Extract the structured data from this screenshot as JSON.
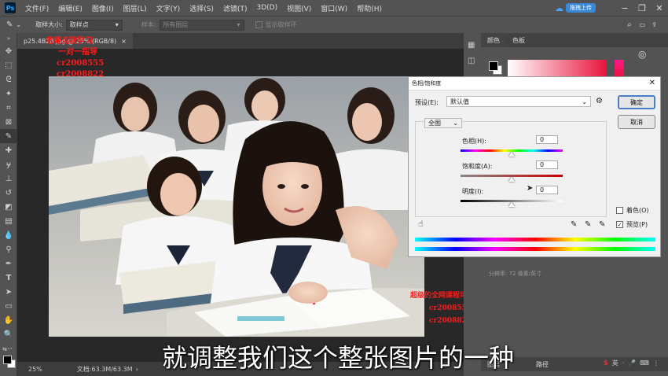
{
  "menubar": {
    "logo": "Ps",
    "items": [
      "文件(F)",
      "编辑(E)",
      "图像(I)",
      "图层(L)",
      "文字(Y)",
      "选择(S)",
      "滤镜(T)",
      "3D(D)",
      "视图(V)",
      "窗口(W)",
      "帮助(H)"
    ],
    "upload_label": "拖拽上传"
  },
  "options": {
    "sample_size_label": "取样大小:",
    "sample_size_value": "取样点",
    "sample_label": "样本:",
    "sample_value": "所有图层",
    "show_ring_label": "显示取样环"
  },
  "document": {
    "tab_label": "p25.4B28.jpg @ 25% (RGB/8)",
    "zoom": "25%",
    "doc_info": "文档:63.3M/63.3M"
  },
  "watermarks": {
    "top_lines": [
      "老师点我学习",
      "一对一指导",
      "cr2008555",
      "cr2008822"
    ],
    "bottom_lines": [
      "超级的全网课程可看",
      "cr2008555",
      "cr2008822"
    ]
  },
  "subtitle": "就调整我们这个整张图片的一种",
  "panels": {
    "color_tab": "颜色",
    "swatches_tab": "色板",
    "resolution_text": "分辨率: 72 像素/英寸",
    "layers_tab": "图层",
    "paths_tab": "路径",
    "colors": {
      "fg": "#000000",
      "bg": "#ffffff",
      "accent": "#e8143c"
    }
  },
  "dialog": {
    "title": "色相/饱和度",
    "preset_label": "预设(E):",
    "preset_value": "默认值",
    "ok": "确定",
    "cancel": "取消",
    "channel": "全图",
    "hue_label": "色相(H):",
    "hue_value": "0",
    "saturation_label": "饱和度(A):",
    "saturation_value": "0",
    "lightness_label": "明度(I):",
    "lightness_value": "0",
    "colorize_label": "着色(O)",
    "preview_label": "预览(P)",
    "colorize_checked": false,
    "preview_checked": true
  },
  "taskbar": {
    "ime_label": "英"
  }
}
